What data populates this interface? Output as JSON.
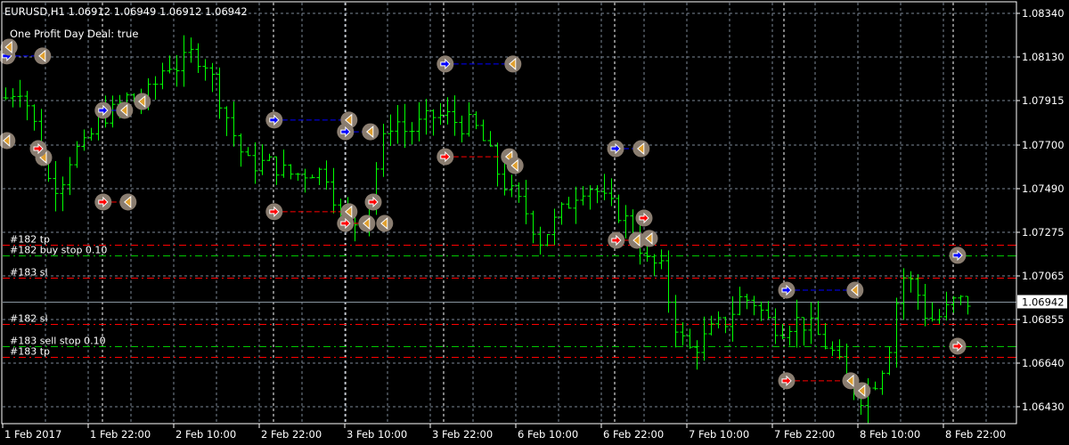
{
  "header": {
    "symbol_line": "EURUSD,H1  1.06912 1.06949 1.06912 1.06942",
    "indicator_text": "One Profit Day Deal: true"
  },
  "colors": {
    "background": "#000000",
    "bar": "#00ff00",
    "grid": "#7c8796",
    "buy": "#0000ff",
    "sell": "#ff0000",
    "exit": "#e0a030",
    "marker_bg": "#8a7d70",
    "bid_line": "#8a96a0"
  },
  "price_axis": {
    "labels": [
      "1.08340",
      "1.08130",
      "1.07915",
      "1.07700",
      "1.07490",
      "1.07275",
      "1.07065",
      "1.06855",
      "1.06640",
      "1.06430"
    ],
    "current_price": "1.06942",
    "range": [
      1.0643,
      1.0834
    ]
  },
  "time_axis": {
    "labels": [
      "1 Feb 2017",
      "1 Feb 22:00",
      "2 Feb 10:00",
      "2 Feb 22:00",
      "3 Feb 10:00",
      "3 Feb 22:00",
      "6 Feb 10:00",
      "6 Feb 22:00",
      "7 Feb 10:00",
      "7 Feb 22:00",
      "8 Feb 10:00",
      "8 Feb 22:00"
    ],
    "bars_per_label": 12
  },
  "order_lines": [
    {
      "label": "#182 tp",
      "price": 1.07217,
      "type": "tp"
    },
    {
      "label": "#182 buy stop 0.10",
      "price": 1.07165,
      "type": "pending"
    },
    {
      "label": "#183 sl",
      "price": 1.07057,
      "type": "sl"
    },
    {
      "label": "#182 sl",
      "price": 1.06832,
      "type": "sl"
    },
    {
      "label": "#183 sell stop 0.10",
      "price": 1.06724,
      "type": "pending"
    },
    {
      "label": "#183 tp",
      "price": 1.06672,
      "type": "tp"
    }
  ],
  "chart_data": {
    "type": "ohlc",
    "symbol": "EURUSD",
    "timeframe": "H1",
    "last": {
      "open": 1.06912,
      "high": 1.06949,
      "low": 1.06912,
      "close": 1.06942
    },
    "sampled_prices": [
      1.0793,
      1.0799,
      1.0784,
      1.0754,
      1.075,
      1.0767,
      1.0769,
      1.0784,
      1.0786,
      1.0793,
      1.0791,
      1.0797,
      1.081,
      1.0808,
      1.0815,
      1.081,
      1.0793,
      1.0776,
      1.0761,
      1.0761,
      1.0761,
      1.0756,
      1.0756,
      1.0758,
      1.0756,
      1.0737,
      1.0732,
      1.0737,
      1.0767,
      1.0784,
      1.0776,
      1.078,
      1.0784,
      1.0784,
      1.078,
      1.078,
      1.0769,
      1.0754,
      1.0745,
      1.0737,
      1.0724,
      1.0732,
      1.0741,
      1.075,
      1.075,
      1.0741,
      1.0737,
      1.0728,
      1.0713,
      1.0711,
      1.0685,
      1.067,
      1.0674,
      1.0681,
      1.0685,
      1.0696,
      1.0694,
      1.0685,
      1.0681,
      1.0685,
      1.0683,
      1.0676,
      1.0668,
      1.0655,
      1.0648,
      1.0655,
      1.0668,
      1.0707,
      1.0702,
      1.0685,
      1.0687,
      1.0694,
      1.0694
    ],
    "trades": [
      {
        "side": "buy",
        "open": [
          0.6,
          1.08133
        ],
        "close": [
          [
            5.6,
            1.08133
          ]
        ]
      },
      {
        "side": "none",
        "open": null,
        "close": [
          [
            0.9,
            1.08176
          ],
          [
            0.6,
            1.07722
          ]
        ]
      },
      {
        "side": "sell",
        "open": [
          5.0,
          1.07683
        ],
        "close": [
          [
            5.75,
            1.0764
          ]
        ]
      },
      {
        "side": "buy",
        "open": [
          14.1,
          1.07869
        ],
        "close": [
          [
            17.1,
            1.07869
          ],
          [
            19.6,
            1.07912
          ]
        ]
      },
      {
        "side": "sell",
        "open": [
          14.1,
          1.07424
        ],
        "close": [
          [
            17.6,
            1.07424
          ]
        ]
      },
      {
        "side": "buy",
        "open": [
          38.1,
          1.07822
        ],
        "close": [
          [
            48.6,
            1.07822
          ]
        ]
      },
      {
        "side": "buy",
        "open": [
          48.1,
          1.07765
        ],
        "close": [
          [
            51.6,
            1.07765
          ]
        ]
      },
      {
        "side": "sell",
        "open": [
          38.1,
          1.07377
        ],
        "close": [
          [
            48.6,
            1.07377
          ]
        ]
      },
      {
        "side": "sell",
        "open": [
          48.1,
          1.0732
        ],
        "close": [
          [
            51.1,
            1.0732
          ],
          [
            53.6,
            1.0732
          ]
        ]
      },
      {
        "side": "sell",
        "open": [
          52.0,
          1.07424
        ],
        "close": []
      },
      {
        "side": "buy",
        "open": [
          62.1,
          1.08094
        ],
        "close": [
          [
            71.6,
            1.08094
          ]
        ]
      },
      {
        "side": "sell",
        "open": [
          62.1,
          1.07644
        ],
        "close": [
          [
            71.1,
            1.07644
          ],
          [
            71.9,
            1.07601
          ]
        ]
      },
      {
        "side": "buy",
        "open": [
          86.0,
          1.07683
        ],
        "close": [
          [
            89.6,
            1.07683
          ]
        ]
      },
      {
        "side": "sell",
        "open": [
          86.1,
          1.07238
        ],
        "close": [
          [
            89.0,
            1.07238
          ],
          [
            90.75,
            1.07247
          ]
        ]
      },
      {
        "side": "sell",
        "open": [
          90.0,
          1.07346
        ],
        "close": []
      },
      {
        "side": "buy",
        "open": [
          110.0,
          1.06996
        ],
        "close": [
          [
            119.6,
            1.06996
          ]
        ]
      },
      {
        "side": "sell",
        "open": [
          110.0,
          1.06556
        ],
        "close": [
          [
            119.0,
            1.06556
          ],
          [
            120.6,
            1.06508
          ]
        ]
      },
      {
        "side": "buy",
        "open": [
          134.0,
          1.07165
        ],
        "close": []
      },
      {
        "side": "sell",
        "open": [
          134.0,
          1.06724
        ],
        "close": []
      }
    ]
  }
}
